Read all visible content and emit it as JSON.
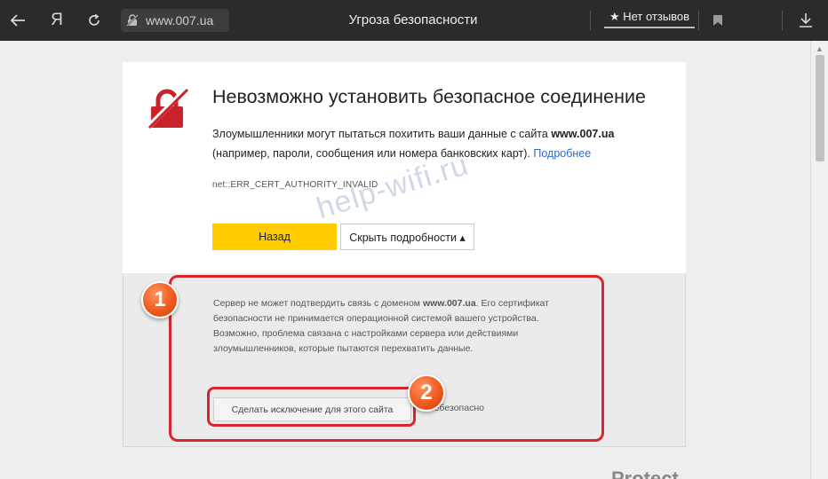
{
  "browser": {
    "ya_label": "Я",
    "address": "www.007.ua",
    "page_title": "Угроза безопасности",
    "reviews_label": "★ Нет отзывов",
    "icons": [
      "back-arrow-icon",
      "reload-icon",
      "broken-lock-icon",
      "bookmark-icon",
      "download-icon"
    ]
  },
  "error": {
    "heading": "Невозможно установить безопасное соединение",
    "desc_prefix": "Злоумышленники могут пытаться похитить ваши данные с сайта ",
    "desc_domain": "www.007.ua",
    "desc_suffix": "(например, пароли, сообщения или номера банковских карт).",
    "more_link": "Подробнее",
    "code": "net::ERR_CERT_AUTHORITY_INVALID",
    "back_button": "Назад",
    "hide_details_button": "Скрыть подробности ▴"
  },
  "details": {
    "text_prefix": "Сервер не может подтвердить связь с доменом ",
    "text_domain": "www.007.ua",
    "text_suffix": ". Его сертификат безопасности не принимается операционной системой вашего устройства. Возможно, проблема связана с настройками сервера или действиями злоумышленников, которые пытаются перехватить данные.",
    "exception_button": "Сделать исключение для этого сайта",
    "unsafe_label": "небезопасно"
  },
  "annotations": {
    "badge_1": "1",
    "badge_2": "2",
    "watermark": "help-wifi.ru"
  },
  "footer": {
    "partial_text": "Protect"
  },
  "colors": {
    "accent_yellow": "#ffcc00",
    "link_blue": "#2f69c9",
    "danger_red": "#d7262d",
    "badge_orange": "#f05a1e"
  }
}
